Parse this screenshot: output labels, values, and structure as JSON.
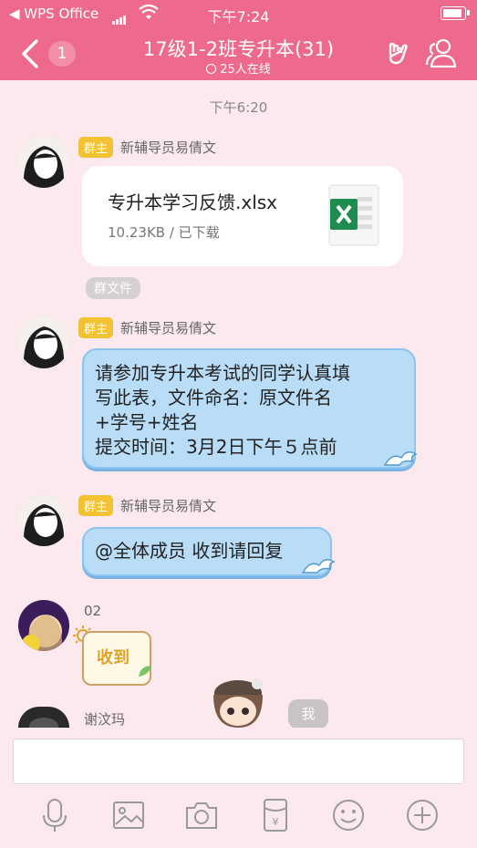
{
  "status": {
    "carrier": "◀ WPS Office",
    "time": "下午7:24"
  },
  "header": {
    "back_count": "1",
    "title": "17级1-2班专升本(31)",
    "online": "25人在线"
  },
  "timestamp": "下午6:20",
  "messages": [
    {
      "role": "群主",
      "sender": "新辅导员易倩文",
      "file_name": "专升本学习反馈.xlsx",
      "file_meta": "10.23KB / 已下载",
      "tag": "群文件"
    },
    {
      "role": "群主",
      "sender": "新辅导员易倩文",
      "lines": [
        "请参加专升本考试的同学认真填",
        "写此表，文件命名：原文件名",
        "+学号+姓名",
        "提交时间：3月2日下午５点前"
      ]
    },
    {
      "role": "群主",
      "sender": "新辅导员易倩文",
      "lines": [
        "@全体成员 收到请回复"
      ]
    },
    {
      "sender": "02",
      "sticker_text": "收到"
    },
    {
      "sender": "谢汶玛",
      "me_label": "我"
    }
  ],
  "colors": {
    "header": "#ee6a8c",
    "background": "#fbe9ee",
    "bubble": "#b9dcf7",
    "role_badge": "#f2c232"
  },
  "icons": [
    "back-icon",
    "hand-gesture-icon",
    "group-members-icon",
    "voice-icon",
    "image-icon",
    "camera-icon",
    "red-packet-icon",
    "emoji-icon",
    "plus-icon"
  ]
}
